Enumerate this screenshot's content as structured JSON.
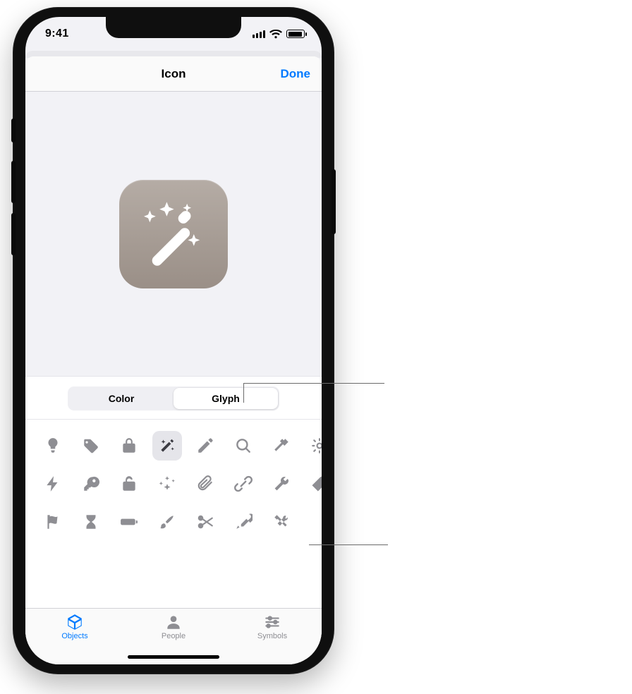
{
  "status": {
    "time": "9:41"
  },
  "nav": {
    "title": "Icon",
    "done": "Done"
  },
  "segment": {
    "color": "Color",
    "glyph": "Glyph",
    "selected": "glyph"
  },
  "glyph_grid": {
    "rows": [
      [
        "lightbulb",
        "tag",
        "lock",
        "wand",
        "pencil",
        "magnifier",
        "hammer",
        "gear-partial"
      ],
      [
        "bolt",
        "key",
        "unlock",
        "sparkles",
        "paperclip",
        "link",
        "wrench",
        "ruler-partial"
      ],
      [
        "flag",
        "hourglass",
        "battery",
        "brush",
        "scissors",
        "eyedropper",
        "tools"
      ]
    ],
    "selected": "wand"
  },
  "tabs": {
    "items": [
      {
        "id": "objects",
        "label": "Objects",
        "icon": "cube-icon"
      },
      {
        "id": "people",
        "label": "People",
        "icon": "person-icon"
      },
      {
        "id": "symbols",
        "label": "Symbols",
        "icon": "sliders-icon"
      }
    ],
    "selected": "objects"
  }
}
